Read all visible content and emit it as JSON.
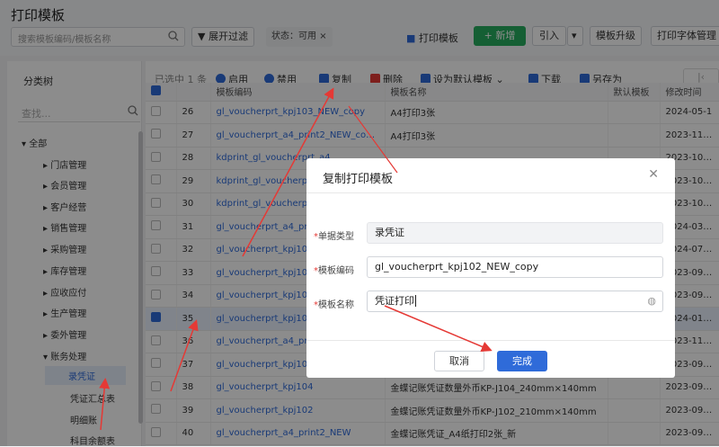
{
  "header": {
    "title": "打印模板",
    "search_placeholder": "搜索模板编码/模板名称",
    "filter_btn": "展开过滤",
    "status_tag": "状态：可用",
    "print_template_btn": "打印模板",
    "new_btn": "新增",
    "import_btn": "引入",
    "upgrade_btn": "模板升级",
    "font_btn": "打印字体管理"
  },
  "sidebar": {
    "title": "分类树",
    "search_placeholder": "查找...",
    "items": [
      "全部",
      "门店管理",
      "会员管理",
      "客户经营",
      "销售管理",
      "采购管理",
      "库存管理",
      "应收应付",
      "生产管理",
      "委外管理",
      "账务处理",
      "录凭证",
      "凭证汇总表",
      "明细账",
      "科目余额表"
    ]
  },
  "toolbar": {
    "selected": "已选中 1 条",
    "enable": "启用",
    "disable": "禁用",
    "copy": "复制",
    "delete": "删除",
    "set_default": "设为默认模板",
    "download": "下载",
    "save_as": "另存为"
  },
  "table": {
    "headers": [
      "模板编码",
      "模板名称",
      "默认模板",
      "修改时间"
    ],
    "rows": [
      {
        "no": "26",
        "code": "gl_voucherprt_kpj103_NEW_copy",
        "name": "A4打印3张",
        "date": "2024-05-1"
      },
      {
        "no": "27",
        "code": "gl_voucherprt_a4_print2_NEW_copy1",
        "name": "A4打印3张",
        "date": "2023-11-07"
      },
      {
        "no": "28",
        "code": "kdprint_gl_voucherprt_a4",
        "name": "",
        "date": "2023-10-28"
      },
      {
        "no": "29",
        "code": "kdprint_gl_voucherprt",
        "name": "",
        "date": "2023-10-28"
      },
      {
        "no": "30",
        "code": "kdprint_gl_voucherprt",
        "name": "",
        "date": "2023-10-28"
      },
      {
        "no": "31",
        "code": "gl_voucherprt_a4_print",
        "name": "",
        "date": "2024-03-14"
      },
      {
        "no": "32",
        "code": "gl_voucherprt_kpj103",
        "name": "",
        "date": "2024-07-29"
      },
      {
        "no": "33",
        "code": "gl_voucherprt_kpj104",
        "name": "",
        "date": "2023-09-26"
      },
      {
        "no": "34",
        "code": "gl_voucherprt_kpj104",
        "name": "",
        "date": "2023-09-26"
      },
      {
        "no": "35",
        "code": "gl_voucherprt_kpj102",
        "name": "",
        "date": "2024-01-31"
      },
      {
        "no": "36",
        "code": "gl_voucherprt_a4_print",
        "name": "",
        "date": "2023-11-14"
      },
      {
        "no": "37",
        "code": "gl_voucherprt_kpj105",
        "name": "",
        "date": "2023-09-26"
      },
      {
        "no": "38",
        "code": "gl_voucherprt_kpj104",
        "name": "金蝶记账凭证数量外币KP-J104_240mm×140mm",
        "date": "2023-09-26"
      },
      {
        "no": "39",
        "code": "gl_voucherprt_kpj102",
        "name": "金蝶记账凭证数量外币KP-J102_210mm×140mm",
        "date": "2023-09-26"
      },
      {
        "no": "40",
        "code": "gl_voucherprt_a4_print2_NEW",
        "name": "金蝶记账凭证_A4纸打印2张_新",
        "date": "2023-09-26"
      }
    ]
  },
  "dialog": {
    "title": "复制打印模板",
    "doc_type_label": "单据类型",
    "doc_type_value": "录凭证",
    "code_label": "模板编码",
    "code_value": "gl_voucherprt_kpj102_NEW_copy",
    "name_label": "模板名称",
    "name_value": "凭证打印",
    "cancel": "取消",
    "ok": "完成"
  },
  "colors": {
    "accent": "#2f6bd9",
    "green": "#27ae60",
    "arrow": "#e53935"
  }
}
